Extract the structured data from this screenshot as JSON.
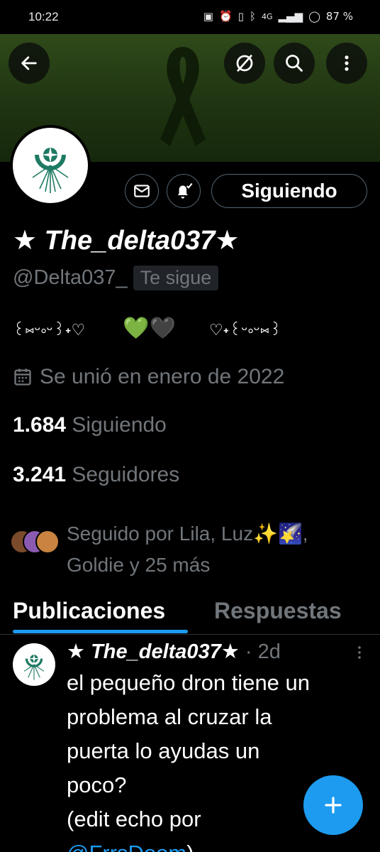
{
  "status_bar": {
    "time": "10:22",
    "battery": "87 %",
    "network": "4G"
  },
  "profile": {
    "display_name_prefix": "★ ",
    "display_name_core": "The_delta037",
    "display_name_suffix": "★",
    "handle": "@Delta037_",
    "follows_you": "Te sigue",
    "bio_left": "꒰⑅ᵕ༚ᵕ꒱˖♡",
    "bio_hearts": "💚🖤",
    "bio_right": "♡˖꒰ᵕ༚ᵕ⑅꒱",
    "joined": "Se unió en enero de 2022",
    "following_count": "1.684",
    "following_label": "Siguiendo",
    "followers_count": "3.241",
    "followers_label": "Seguidores",
    "followed_by_line1": "Seguido por Lila, Luz✨🌠,",
    "followed_by_line2": "Goldie y 25 más"
  },
  "actions": {
    "following_button": "Siguiendo"
  },
  "tabs": [
    {
      "label": "Publicaciones",
      "active": true
    },
    {
      "label": "Respuestas",
      "active": false
    }
  ],
  "post": {
    "name_prefix": "★ ",
    "name_core": "The_delta037",
    "name_suffix": "★",
    "meta": " · 2d",
    "lines": [
      "el pequeño dron tiene un",
      "problema al cruzar la",
      "puerta lo ayudas un",
      "poco?",
      "(edit echo por"
    ],
    "mention": "@FrrsDoom",
    "after_mention": ")"
  },
  "colors": {
    "accent": "#1d9bf0",
    "banner": "#2f4a1a",
    "text_secondary": "#71767b"
  },
  "icons": [
    "back-arrow-icon",
    "grok-icon",
    "search-icon",
    "more-vertical-icon",
    "mail-icon",
    "bell-check-icon",
    "calendar-icon",
    "plus-icon"
  ]
}
